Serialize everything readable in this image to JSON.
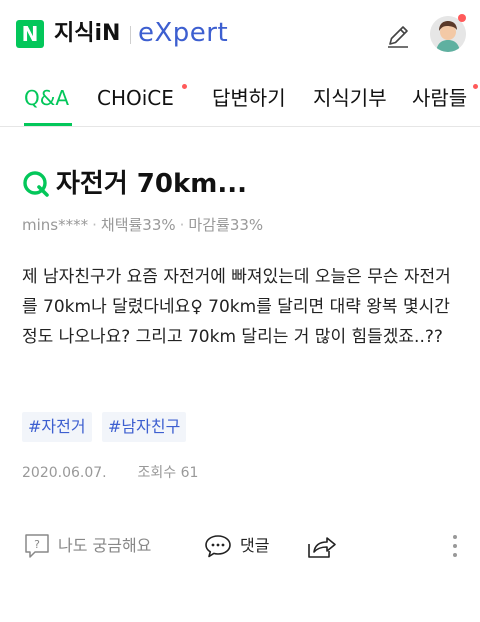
{
  "header": {
    "logo_letter": "N",
    "service_name": "지식iN",
    "expert_label": "eXpert"
  },
  "tabs": [
    {
      "label": "Q&A",
      "active": true
    },
    {
      "label": "CHOiCE",
      "dot": true
    },
    {
      "label": "답변하기"
    },
    {
      "label": "지식기부"
    },
    {
      "label": "사람들",
      "dot": true
    }
  ],
  "question": {
    "title": "자전거 70km...",
    "author": "mins****",
    "adopt_rate": "채택률33%",
    "deadline_rate": "마감률33%",
    "body": "제 남자친구가 요즘 자전거에 빠져있는데 오늘은 무슨 자전거를 70km나 달렸다네요♀  70km를 달리면 대략 왕복 몇시간 정도 나오나요? 그리고 70km 달리는 거 많이 힘들겠죠..??",
    "tags": [
      "#자전거",
      "#남자친구"
    ],
    "date": "2020.06.07.",
    "views": "조회수 61"
  },
  "actions": {
    "curious_label": "나도 궁금해요",
    "comment_label": "댓글"
  },
  "colors": {
    "brand_green": "#03c75a",
    "expert_blue": "#3d5fd0",
    "notify_red": "#ff5a5a"
  }
}
